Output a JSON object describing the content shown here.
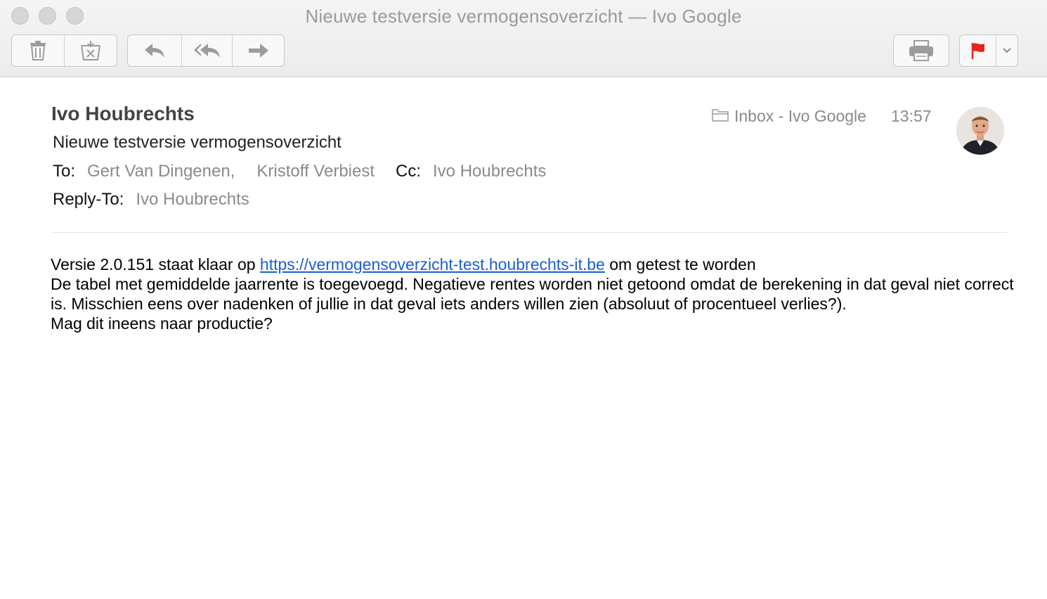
{
  "window": {
    "title": "Nieuwe testversie vermogensoverzicht — Ivo Google"
  },
  "toolbar": {
    "delete_icon": "trash-icon",
    "junk_icon": "junk-icon",
    "reply_icon": "reply-icon",
    "reply_all_icon": "reply-all-icon",
    "forward_icon": "forward-icon",
    "print_icon": "printer-icon",
    "flag_icon": "flag-icon",
    "flag_color": "#e8231b"
  },
  "header": {
    "sender": "Ivo Houbrechts",
    "subject": "Nieuwe testversie vermogensoverzicht",
    "to_label": "To:",
    "to_recipients": [
      "Gert Van Dingenen,",
      "Kristoff Verbiest"
    ],
    "cc_label": "Cc:",
    "cc_recipients": [
      "Ivo Houbrechts"
    ],
    "reply_to_label": "Reply-To:",
    "reply_to": "Ivo Houbrechts",
    "mailbox": "Inbox - Ivo Google",
    "time": "13:57"
  },
  "body": {
    "line1_before": "Versie 2.0.151 staat klaar op ",
    "link": "https://vermogensoverzicht-test.houbrechts-it.be",
    "line1_after": " om getest te worden",
    "line2": "De tabel met gemiddelde jaarrente is toegevoegd. Negatieve rentes worden niet getoond omdat de berekening in dat geval niet correct is. Misschien eens over nadenken of jullie in dat geval iets anders willen zien (absoluut of procentueel verlies?).",
    "line3": "Mag dit ineens naar productie?",
    "link_color": "#1a5fd1"
  }
}
